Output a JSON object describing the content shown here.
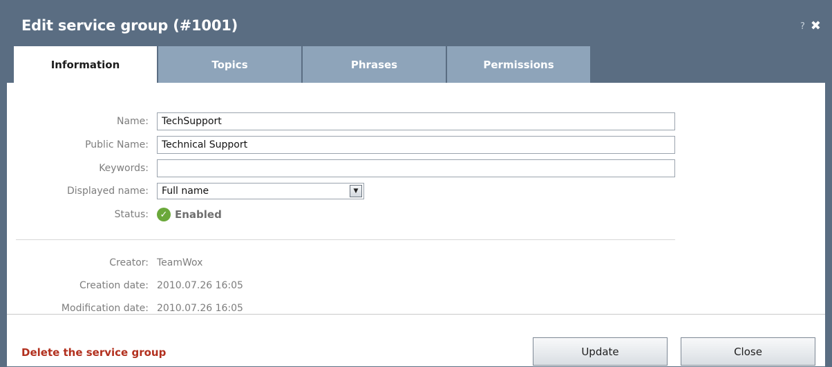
{
  "window": {
    "title": "Edit service group (#1001)",
    "help_glyph": "?",
    "close_glyph": "✖"
  },
  "tabs": [
    {
      "label": "Information",
      "active": true
    },
    {
      "label": "Topics",
      "active": false
    },
    {
      "label": "Phrases",
      "active": false
    },
    {
      "label": "Permissions",
      "active": false
    }
  ],
  "form": {
    "name": {
      "label": "Name:",
      "value": "TechSupport"
    },
    "public_name": {
      "label": "Public Name:",
      "value": "Technical Support"
    },
    "keywords": {
      "label": "Keywords:",
      "value": ""
    },
    "displayed_name": {
      "label": "Displayed name:",
      "value": "Full name"
    },
    "status": {
      "label": "Status:",
      "value": "Enabled",
      "icon": "check-circle-icon",
      "color": "#6aa83a"
    }
  },
  "info": {
    "creator": {
      "label": "Creator:",
      "value": "TeamWox"
    },
    "creation_date": {
      "label": "Creation date:",
      "value": "2010.07.26 16:05"
    },
    "modification_date": {
      "label": "Modification date:",
      "value": "2010.07.26 16:05"
    }
  },
  "footer": {
    "delete_label": "Delete the service group",
    "update_label": "Update",
    "close_label": "Close"
  },
  "colors": {
    "titlebar": "#5a6d82",
    "tab_inactive": "#8ea4ba",
    "delete_link": "#b2301e"
  }
}
